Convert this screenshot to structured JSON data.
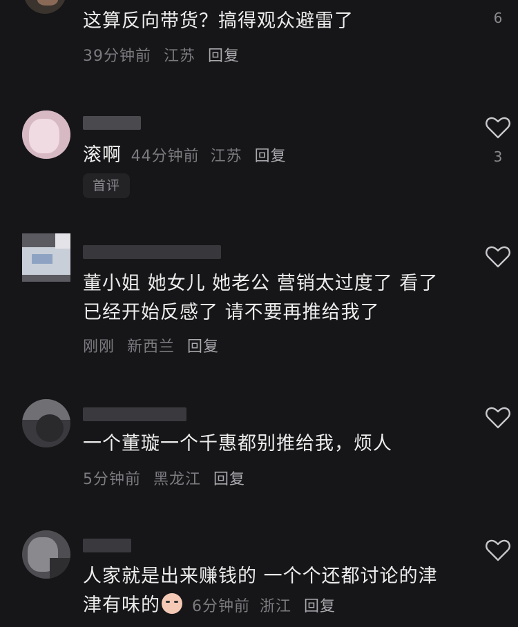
{
  "comments": [
    {
      "text": "这算反向带货？搞得观众避雷了",
      "time": "39分钟前",
      "location": "江苏",
      "reply": "回复",
      "likes": "6"
    },
    {
      "text": "滚啊",
      "time": "44分钟前",
      "location": "江苏",
      "reply": "回复",
      "likes": "3",
      "badge": "首评"
    },
    {
      "text_line1": "董小姐 她女儿 她老公 营销太过度了 看了",
      "text_line2": "已经开始反感了 请不要再推给我了",
      "time": "刚刚",
      "location": "新西兰",
      "reply": "回复"
    },
    {
      "text": "一个董璇一个千惠都别推给我，烦人",
      "time": "5分钟前",
      "location": "黑龙江",
      "reply": "回复"
    },
    {
      "text_line1": "人家就是出来赚钱的 一个个还都讨论的津",
      "text_line2": "津有味的",
      "emoji": "crying-face-emoji",
      "time": "6分钟前",
      "location": "浙江",
      "reply": "回复"
    }
  ],
  "icons": {
    "like": "heart-outline-icon"
  },
  "colors": {
    "background": "#161618",
    "text": "#ececec",
    "meta": "#7b7b80"
  }
}
